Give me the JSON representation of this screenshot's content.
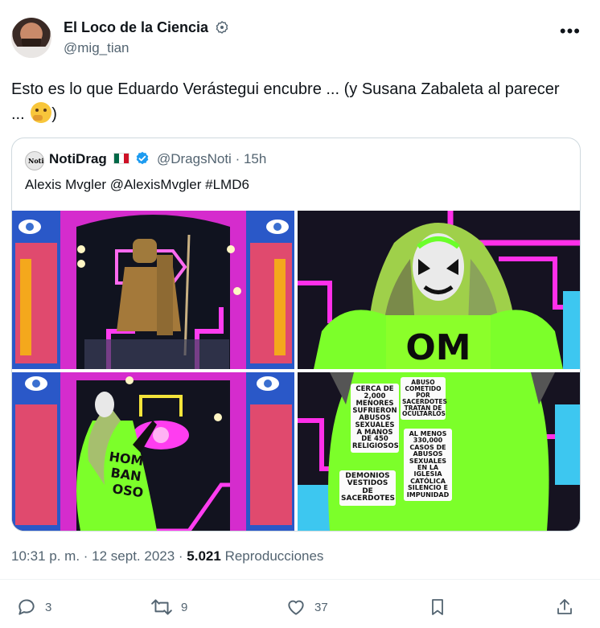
{
  "tweet": {
    "author_name": "El Loco de la Ciencia",
    "author_handle": "@mig_tian",
    "text": "Esto es lo que Eduardo Verástegui encubre ... (y Susana Zabaleta al parecer ...",
    "text_tail": ")",
    "timestamp": "10:31 p. m. · 12 sept. 2023 · ",
    "views_count": "5.021",
    "views_label": "Reproducciones"
  },
  "quote": {
    "avatar_text": "Noti",
    "author_name": "NotiDrag",
    "author_handle": "@DragsNoti",
    "time": "· 15h",
    "text": "Alexis Mvgler @AlexisMvgler #LMD6"
  },
  "signs": {
    "sign1": "CERCA DE 2,000 MENORES SUFRIERON ABUSOS SEXUALES A MANOS DE 450 RELIGIOSOS",
    "sign2": "ABUSO COMETIDO POR SACERDOTES TRATAN DE OCULTARLOS",
    "sign3": "AL MENOS 330,000 CASOS DE ABUSOS SEXUALES EN LA IGLESIA CATÓLICA SILENCIO E IMPUNIDAD",
    "sign4": "DEMONIOS VESTIDOS DE SACERDOTES"
  },
  "actions": {
    "replies": "3",
    "retweets": "9",
    "likes": "37"
  },
  "icons": [
    "verified-icon",
    "more-icon",
    "flag-mexico-icon",
    "blue-check-icon",
    "reply-icon",
    "retweet-icon",
    "like-icon",
    "bookmark-icon",
    "share-icon",
    "thinking-face-emoji"
  ],
  "colors": {
    "accent": "#1d9bf0",
    "text": "#0f1419",
    "secondary": "#536471",
    "border": "#cfd9de",
    "neon_green": "#7cff2a"
  }
}
